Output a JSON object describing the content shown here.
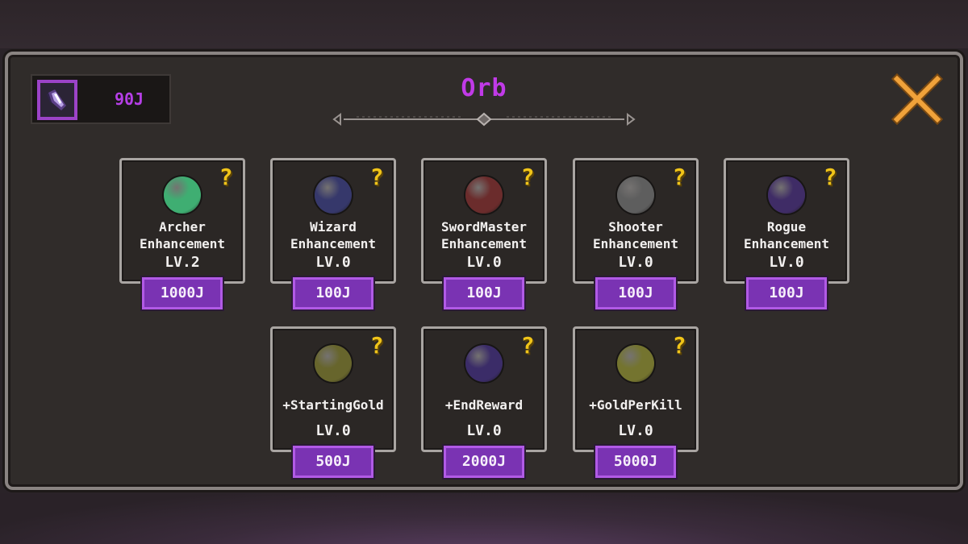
{
  "title": "Orb",
  "currency": {
    "value": "90J",
    "icon": "crystal-shard-icon",
    "accent": "#b53fe6"
  },
  "close_icon": "close-x-icon",
  "help_glyph": "?",
  "cards": [
    {
      "id": "archer",
      "name_line1": "Archer",
      "name_line2": "Enhancement",
      "level": "LV.2",
      "price": "1000J",
      "orb_color": "#3fae72"
    },
    {
      "id": "wizard",
      "name_line1": "Wizard",
      "name_line2": "Enhancement",
      "level": "LV.0",
      "price": "100J",
      "orb_color": "#36386b"
    },
    {
      "id": "swordmaster",
      "name_line1": "SwordMaster",
      "name_line2": "Enhancement",
      "level": "LV.0",
      "price": "100J",
      "orb_color": "#6b2c2c"
    },
    {
      "id": "shooter",
      "name_line1": "Shooter",
      "name_line2": "Enhancement",
      "level": "LV.0",
      "price": "100J",
      "orb_color": "#5e5e5e"
    },
    {
      "id": "rogue",
      "name_line1": "Rogue",
      "name_line2": "Enhancement",
      "level": "LV.0",
      "price": "100J",
      "orb_color": "#3f2c66"
    },
    {
      "id": "starting-gold",
      "name_line1": "+StartingGold",
      "level": "LV.0",
      "price": "500J",
      "orb_color": "#67652c"
    },
    {
      "id": "end-reward",
      "name_line1": "+EndReward",
      "level": "LV.0",
      "price": "2000J",
      "orb_color": "#3b2c68"
    },
    {
      "id": "gold-per-kill",
      "name_line1": "+GoldPerKill",
      "level": "LV.0",
      "price": "5000J",
      "orb_color": "#74742f"
    }
  ]
}
